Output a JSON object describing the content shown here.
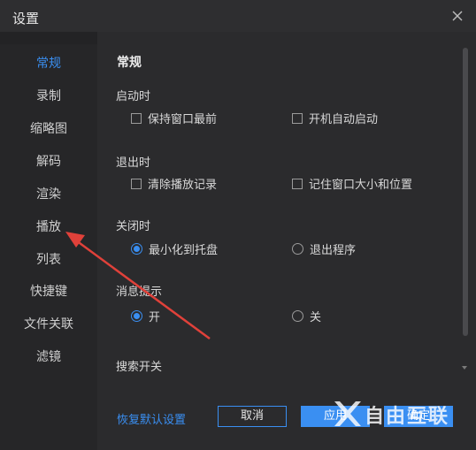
{
  "window": {
    "title": "设置",
    "close_icon": "close-icon"
  },
  "sidebar": {
    "items": [
      {
        "label": "常规",
        "active": true
      },
      {
        "label": "录制",
        "active": false
      },
      {
        "label": "缩略图",
        "active": false
      },
      {
        "label": "解码",
        "active": false
      },
      {
        "label": "渲染",
        "active": false
      },
      {
        "label": "播放",
        "active": false
      },
      {
        "label": "列表",
        "active": false
      },
      {
        "label": "快捷键",
        "active": false
      },
      {
        "label": "文件关联",
        "active": false
      },
      {
        "label": "滤镜",
        "active": false
      }
    ]
  },
  "main": {
    "section_title": "常规",
    "startup": {
      "label": "启动时",
      "opt1": "保持窗口最前",
      "opt1_checked": false,
      "opt2": "开机自动启动",
      "opt2_checked": false
    },
    "exit": {
      "label": "退出时",
      "opt1": "清除播放记录",
      "opt1_checked": false,
      "opt2": "记住窗口大小和位置",
      "opt2_checked": false
    },
    "close": {
      "label": "关闭时",
      "opt1": "最小化到托盘",
      "opt2": "退出程序",
      "selected": "最小化到托盘"
    },
    "message": {
      "label": "消息提示",
      "opt1": "开",
      "opt2": "关",
      "selected": "开"
    },
    "search": {
      "label": "搜索开关"
    }
  },
  "footer": {
    "restore_label": "恢复默认设置",
    "cancel_label": "取消",
    "apply_label": "应用",
    "ok_label": "确定"
  },
  "watermark": {
    "text": "自由互联"
  },
  "colors": {
    "accent": "#3a8ff2",
    "annotation_arrow": "#e0413a",
    "background": "#2b2b2d",
    "sidebar": "#262628"
  }
}
